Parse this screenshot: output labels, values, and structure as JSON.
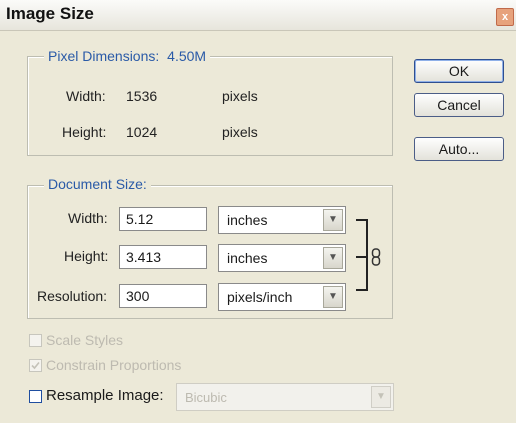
{
  "window": {
    "title": "Image Size",
    "close_glyph": "x"
  },
  "pixel_dimensions": {
    "legend": "Pixel Dimensions:",
    "size": "4.50M",
    "width_label": "Width:",
    "width_value": "1536",
    "width_unit": "pixels",
    "height_label": "Height:",
    "height_value": "1024",
    "height_unit": "pixels"
  },
  "document_size": {
    "legend": "Document Size:",
    "width_label": "Width:",
    "width_value": "5.12",
    "width_unit": "inches",
    "height_label": "Height:",
    "height_value": "3.413",
    "height_unit": "inches",
    "resolution_label": "Resolution:",
    "resolution_value": "300",
    "resolution_unit": "pixels/inch",
    "link_icon": "chain-link-icon"
  },
  "buttons": {
    "ok": "OK",
    "cancel": "Cancel",
    "auto": "Auto..."
  },
  "options": {
    "scale_styles": "Scale Styles",
    "constrain_proportions": "Constrain Proportions",
    "resample_image": "Resample Image:",
    "resample_method": "Bicubic"
  },
  "colors": {
    "accent": "#2a5aa7",
    "background": "#ece9d8"
  }
}
